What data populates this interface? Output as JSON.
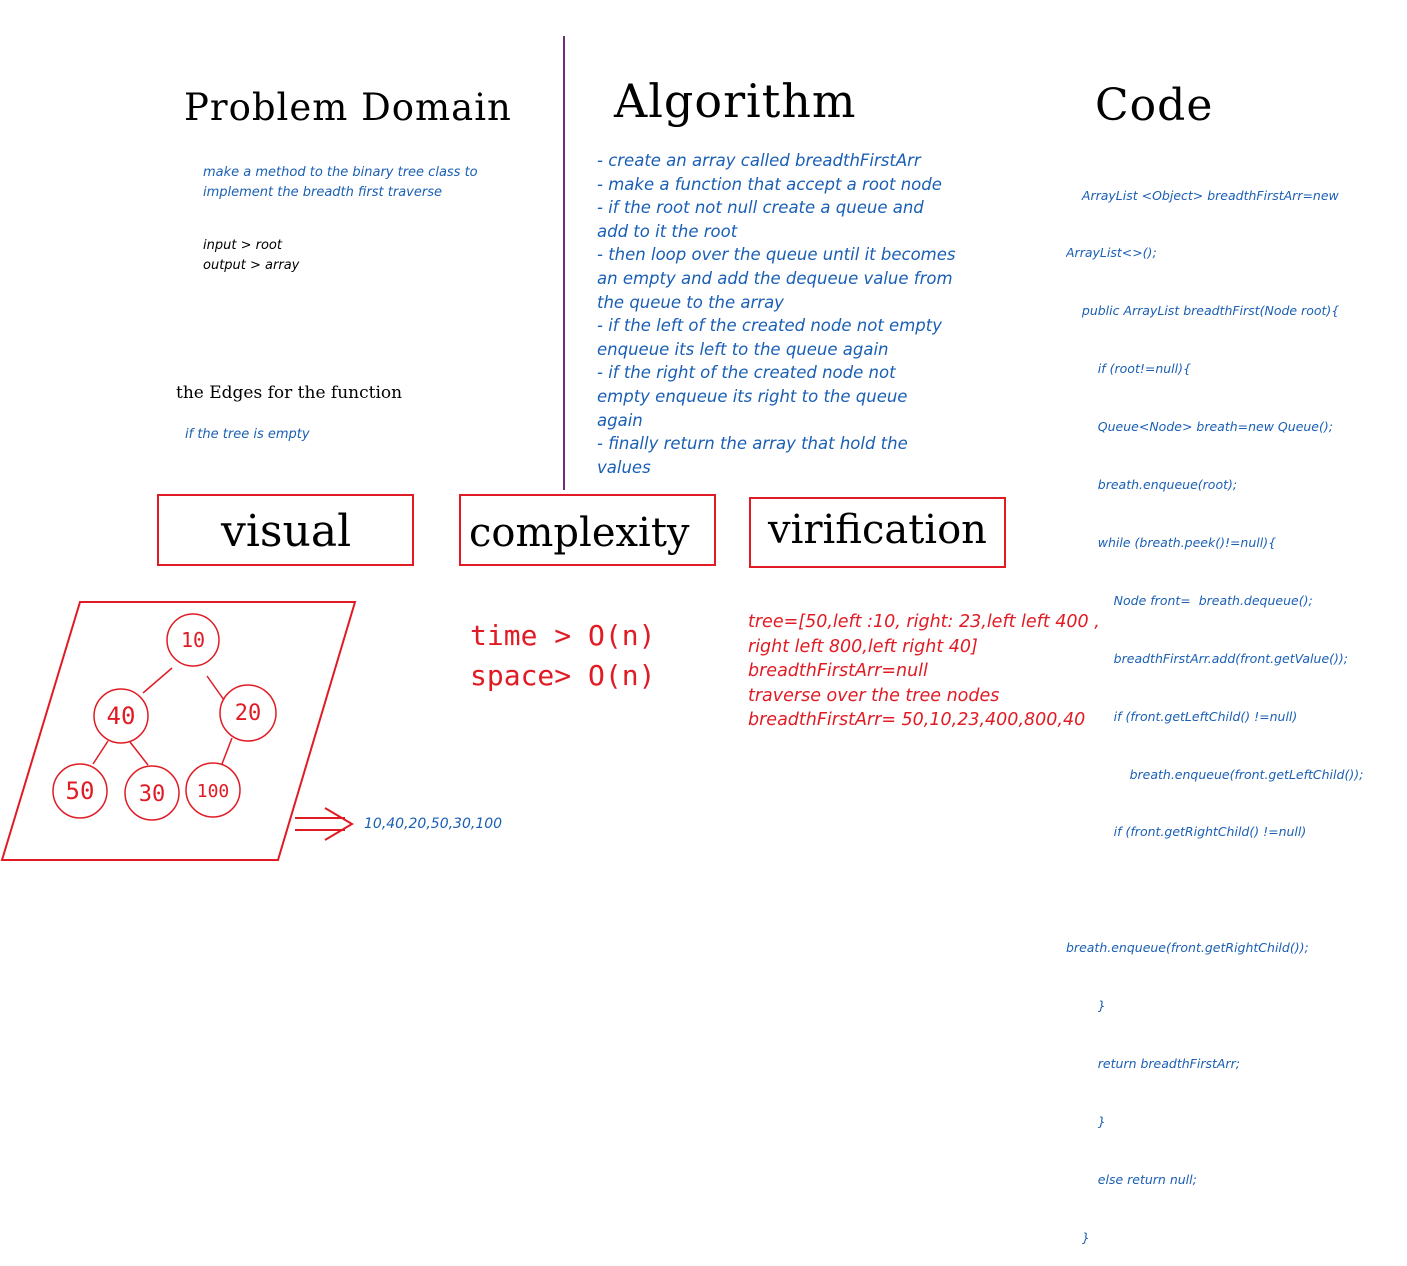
{
  "problem_domain": {
    "title": "Problem Domain",
    "description_line1": "make a method to the binary tree class to",
    "description_line2": "implement the breadth first traverse",
    "input": "input > root",
    "output": "output > array",
    "edges_title": "the Edges for the function",
    "edge_case": "if the tree is empty"
  },
  "algorithm": {
    "title": "Algorithm",
    "lines": [
      "- create an array called breadthFirstArr",
      "- make a function that accept a root node",
      "- if the root not null create a queue and",
      "add to it the root",
      "- then loop over the queue until it becomes",
      "an empty and add the dequeue value from",
      "the queue to the array",
      "- if the left of the created node not empty",
      "enqueue its left to the queue again",
      "- if the right of the created node not",
      "empty enqueue its right to the queue",
      "again",
      "- finally return the array that hold the",
      "values"
    ]
  },
  "code": {
    "title": "Code",
    "lines": [
      "    ArrayList <Object> breadthFirstArr=new",
      "ArrayList<>();",
      "    public ArrayList breadthFirst(Node root){",
      "        if (root!=null){",
      "        Queue<Node> breath=new Queue();",
      "        breath.enqueue(root);",
      "        while (breath.peek()!=null){",
      "            Node front=  breath.dequeue();",
      "            breadthFirstArr.add(front.getValue());",
      "            if (front.getLeftChild() !=null)",
      "                breath.enqueue(front.getLeftChild());",
      "            if (front.getRightChild() !=null)",
      "",
      "breath.enqueue(front.getRightChild());",
      "        }",
      "        return breadthFirstArr;",
      "        }",
      "        else return null;",
      "    }"
    ]
  },
  "boxes": {
    "visual": "visual",
    "complexity": "complexity",
    "verification": "virification"
  },
  "visual": {
    "nodes": [
      "10",
      "40",
      "20",
      "50",
      "30",
      "100"
    ],
    "result": "10,40,20,50,30,100"
  },
  "complexity": {
    "time": "time > O(n)",
    "space": "space> O(n)"
  },
  "verification": {
    "lines": [
      "tree=[50,left :10, right: 23,left left 400 ,",
      "right left 800,left right 40]",
      "breadthFirstArr=null",
      "traverse over the tree nodes",
      "breadthFirstArr= 50,10,23,400,800,40"
    ]
  },
  "colors": {
    "blue_text": "#1a5fb4",
    "red": "#e01b24",
    "divider_left": "#6d2f7a",
    "divider_right": "#c0392b"
  }
}
